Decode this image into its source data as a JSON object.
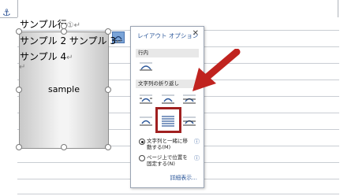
{
  "document": {
    "line1": "サンプル行",
    "line1_mark": "①",
    "line2": "サンプル 2 サンプル 3",
    "line3": "サンプル 4",
    "paragraph_mark": "↵",
    "anchor_icon": "⚓",
    "shape_label": "sample"
  },
  "popup": {
    "title": "レイアウト オプション",
    "close": "✕",
    "inline_header": "行内",
    "wrap_header": "文字列の折り返し",
    "radio1_line1": "文字列と一緒に移",
    "radio1_line2": "動する(M)",
    "radio2_line1": "ページ上で位置を",
    "radio2_line2": "固定する(N)",
    "info": "ⓘ",
    "details": "詳細表示..."
  },
  "colors": {
    "accent": "#2b579a",
    "highlight": "#a02020",
    "arrow": "#c0231f"
  }
}
